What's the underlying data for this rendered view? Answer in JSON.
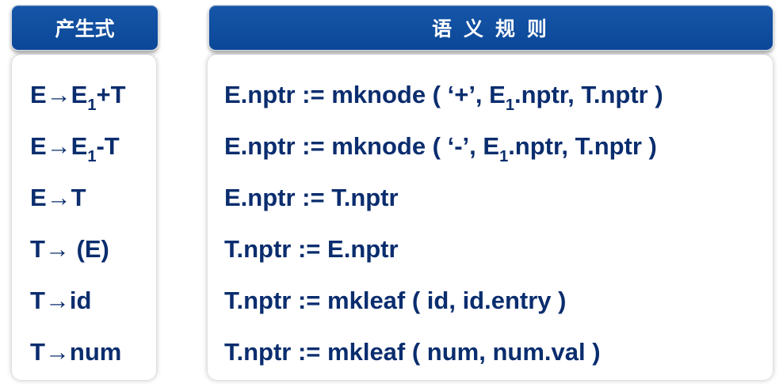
{
  "headers": {
    "productions": "产生式",
    "semantic_rules": "语 义 规 则"
  },
  "productions": [
    {
      "pre": "E→E",
      "sub": "1",
      "post": "+T"
    },
    {
      "pre": "E→E",
      "sub": "1",
      "post": "-T"
    },
    {
      "pre": "E→T",
      "sub": "",
      "post": ""
    },
    {
      "pre": "T→ (E)",
      "sub": "",
      "post": ""
    },
    {
      "pre": "T→id",
      "sub": "",
      "post": ""
    },
    {
      "pre": "T→num",
      "sub": "",
      "post": ""
    }
  ],
  "rules": [
    {
      "pre": "E.nptr := mknode ( ‘+’, E",
      "sub": "1",
      "post": ".nptr, T.nptr )"
    },
    {
      "pre": "E.nptr := mknode ( ‘-’, E",
      "sub": "1",
      "post": ".nptr, T.nptr )"
    },
    {
      "pre": "E.nptr := T.nptr",
      "sub": "",
      "post": ""
    },
    {
      "pre": "T.nptr := E.nptr",
      "sub": "",
      "post": ""
    },
    {
      "pre": "T.nptr := mkleaf ( id, id.entry )",
      "sub": "",
      "post": ""
    },
    {
      "pre": "T.nptr := mkleaf ( num, num.val )",
      "sub": "",
      "post": ""
    }
  ]
}
